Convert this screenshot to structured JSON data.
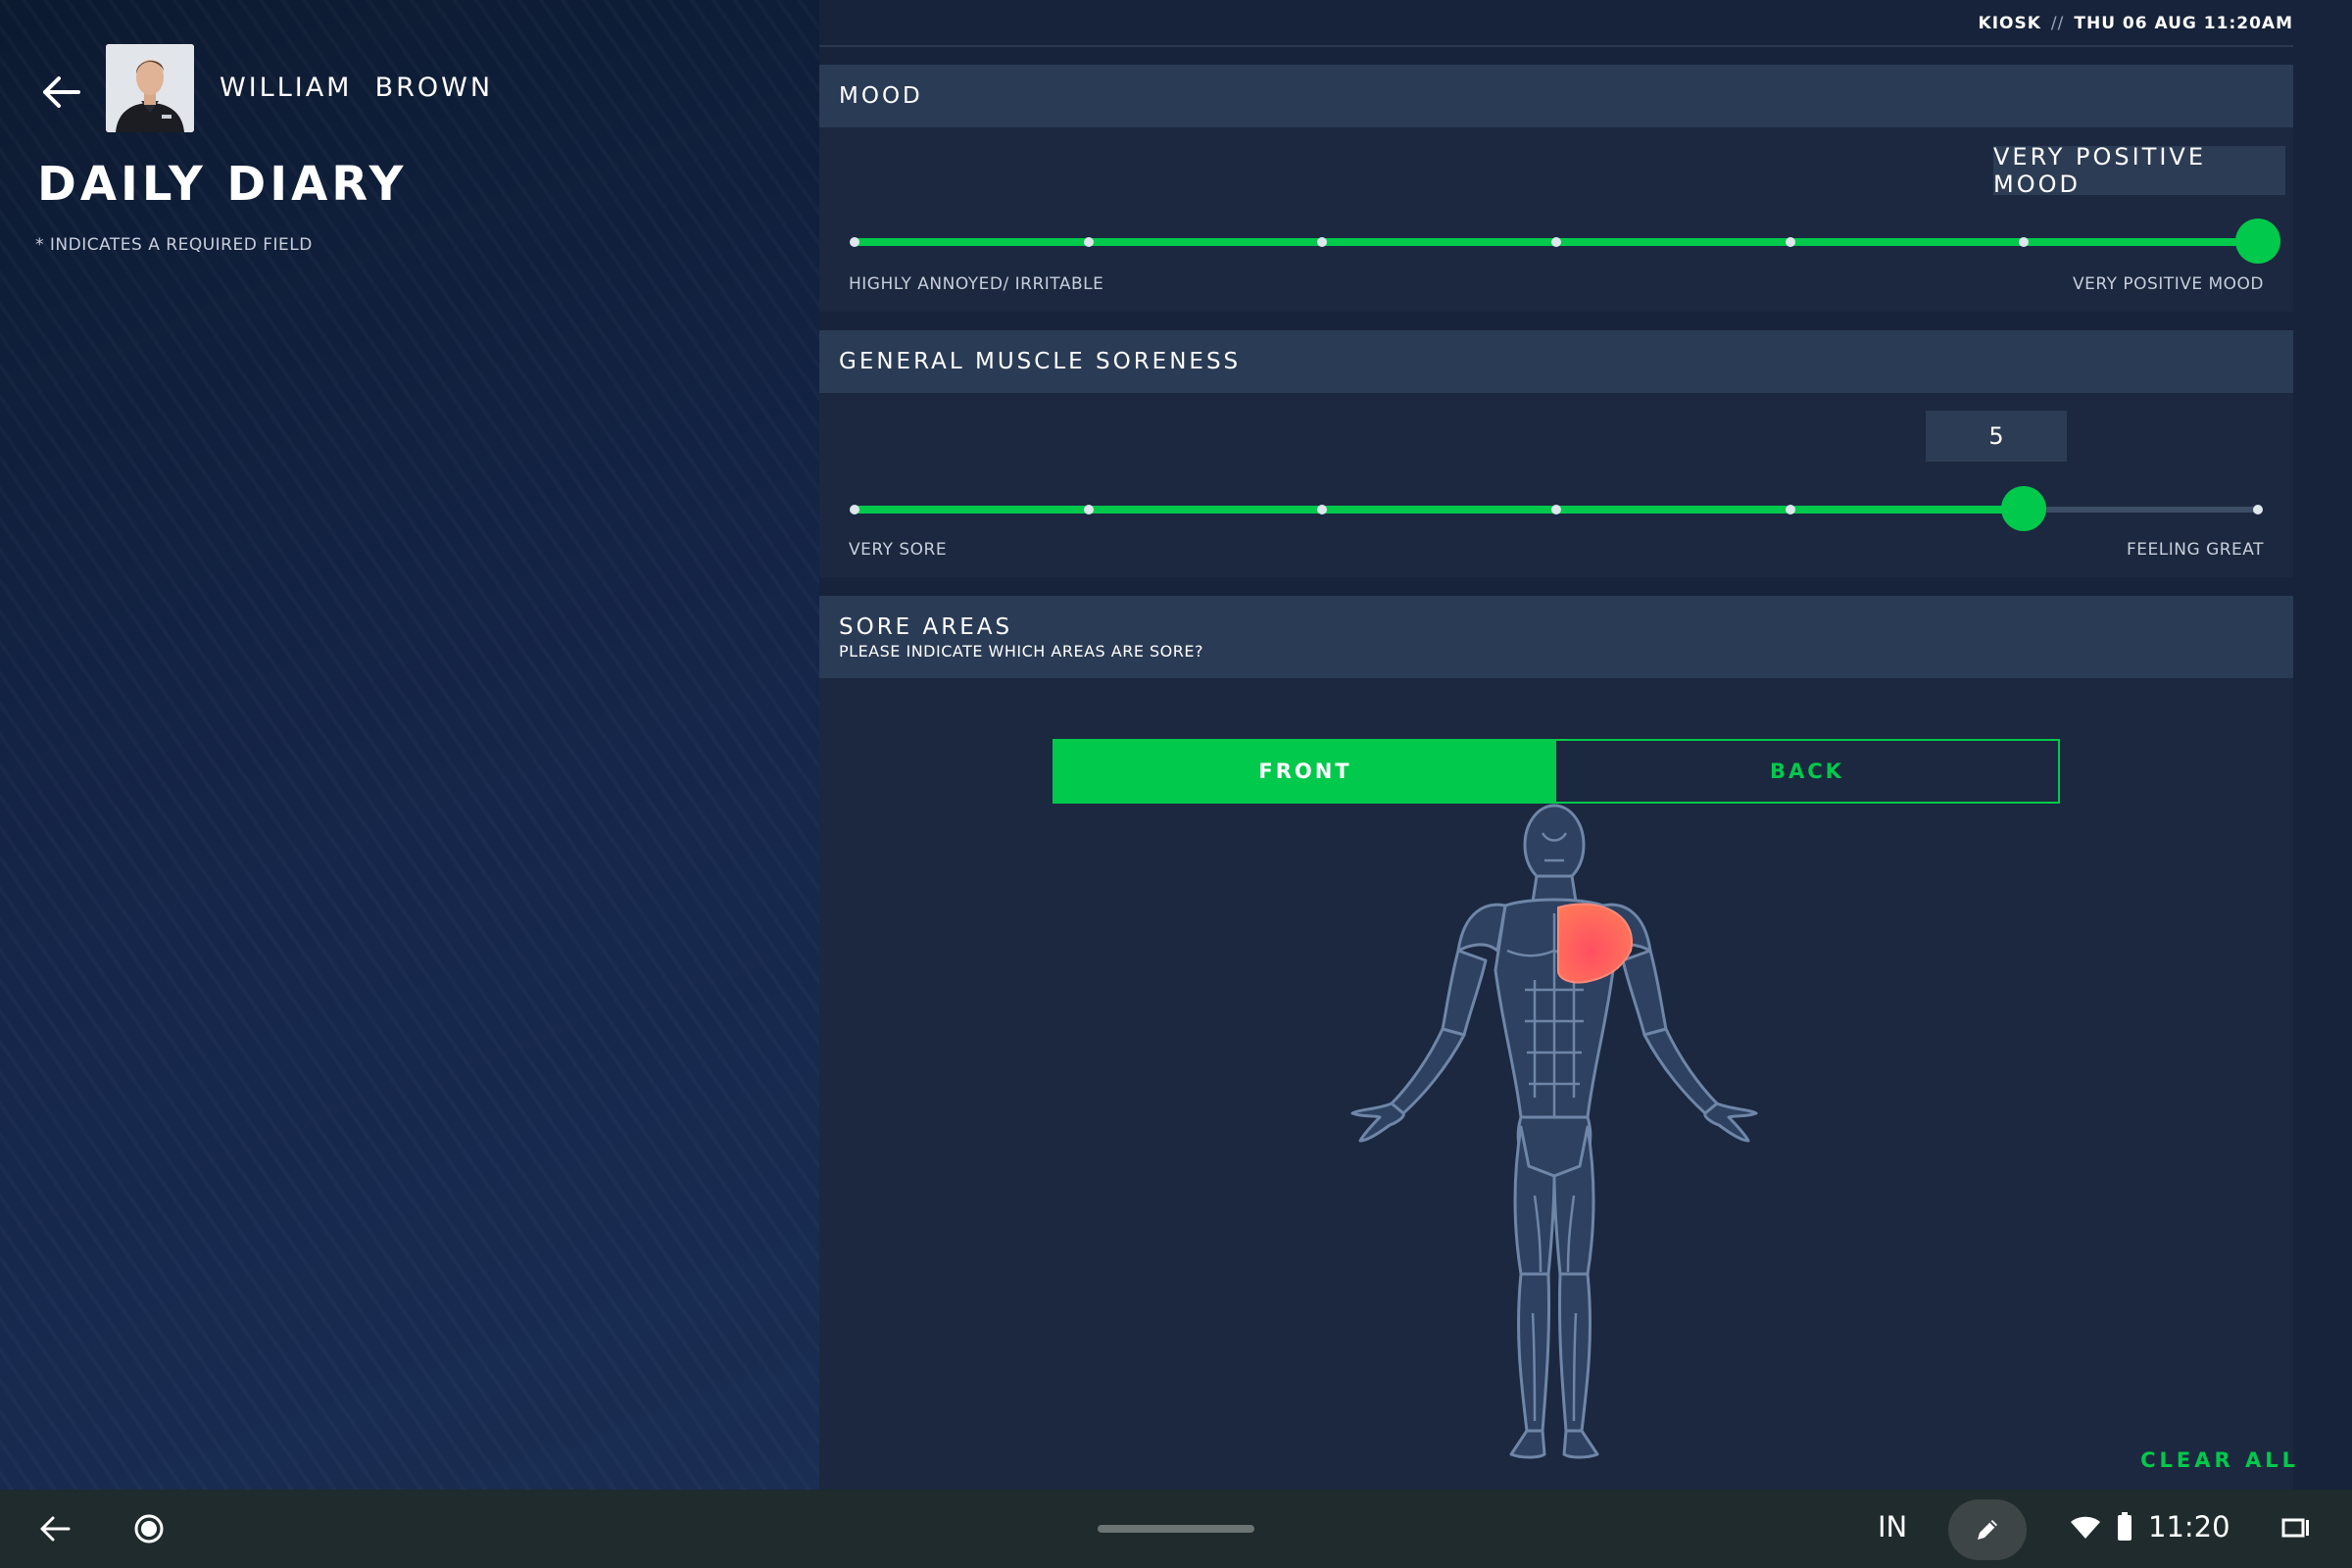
{
  "kiosk": {
    "label": "KIOSK",
    "separator": "//",
    "datetime": "THU 06 AUG 11:20AM"
  },
  "header": {
    "athlete_name": "WILLIAM  BROWN",
    "title": "DAILY DIARY",
    "required_note": "* INDICATES A REQUIRED FIELD"
  },
  "mood": {
    "title": "MOOD",
    "selected_label": "VERY POSITIVE MOOD",
    "level": 7,
    "steps": 7,
    "min_label": "HIGHLY ANNOYED/ IRRITABLE",
    "max_label": "VERY POSITIVE MOOD"
  },
  "soreness": {
    "title": "GENERAL MUSCLE SORENESS",
    "value": "5",
    "level": 6,
    "steps": 7,
    "min_label": "VERY SORE",
    "max_label": "FEELING GREAT"
  },
  "sore_areas": {
    "title": "SORE AREAS",
    "subtitle": "PLEASE INDICATE WHICH AREAS ARE SORE?",
    "tabs": [
      {
        "label": "FRONT",
        "active": true
      },
      {
        "label": "BACK",
        "active": false
      }
    ],
    "selected_areas": [
      "left-chest-shoulder"
    ],
    "clear_label": "CLEAR ALL"
  },
  "colors": {
    "accent": "#00c94c",
    "header_bg": "#2a3b55",
    "card_bg": "#1b283f",
    "sore_highlight": "#ff5f5f"
  },
  "system_bar": {
    "input_method": "IN",
    "time": "11:20",
    "icons": [
      "back-icon",
      "home-circle-icon",
      "pen-icon",
      "wifi-icon",
      "battery-icon",
      "recents-icon"
    ]
  }
}
